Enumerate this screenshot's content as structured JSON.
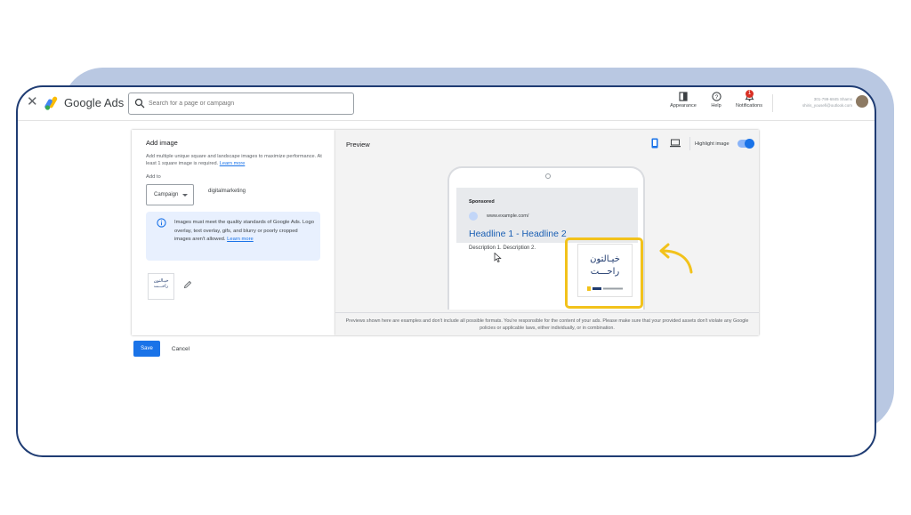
{
  "header": {
    "close_icon": "close-icon",
    "brand": "Google Ads",
    "search_placeholder": "Search for a page or campaign",
    "tools": [
      {
        "label": "Appearance",
        "icon": "appearance-icon"
      },
      {
        "label": "Help",
        "icon": "help-icon"
      },
      {
        "label": "Notifications",
        "icon": "bell-icon",
        "badge": "1"
      }
    ],
    "account_line1": "301-799-6845 Shams",
    "account_line2": "shiris_yousefi@outlook.com"
  },
  "add_image": {
    "title": "Add image",
    "description": "Add multiple unique square and landscape images to maximize performance. At least 1 square image is required.",
    "learn_more": "Learn more",
    "add_to_label": "Add to",
    "level_select": "Campaign",
    "campaign_name": "digitalmarketing",
    "info_text": "Images must meet the quality standards of Google Ads. Logo overlay, text overlay, gifs, and blurry or poorly cropped images aren't allowed.",
    "info_learn_more": "Learn more",
    "thumbnail_text": "خيـالتون راحـــت"
  },
  "preview": {
    "title": "Preview",
    "highlight_label": "Highlight image",
    "highlight_on": true,
    "sponsored": "Sponsored",
    "url": "www.example.com/",
    "headline": "Headline 1 - Headline 2",
    "description": "Description 1. Description 2.",
    "image_text_line1": "خيـالتون",
    "image_text_line2": "راحـــت",
    "disclaimer": "Previews shown here are examples and don't include all possible formats. You're responsible for the content of your ads. Please make sure that your provided assets don't violate any Google policies or applicable laws, either individually, or in combination."
  },
  "actions": {
    "save": "Save",
    "cancel": "Cancel"
  },
  "colors": {
    "accent": "#1a73e8",
    "highlight": "#f2c21b",
    "frame": "#1f3c73",
    "frame_bg": "#b9c8e2"
  }
}
